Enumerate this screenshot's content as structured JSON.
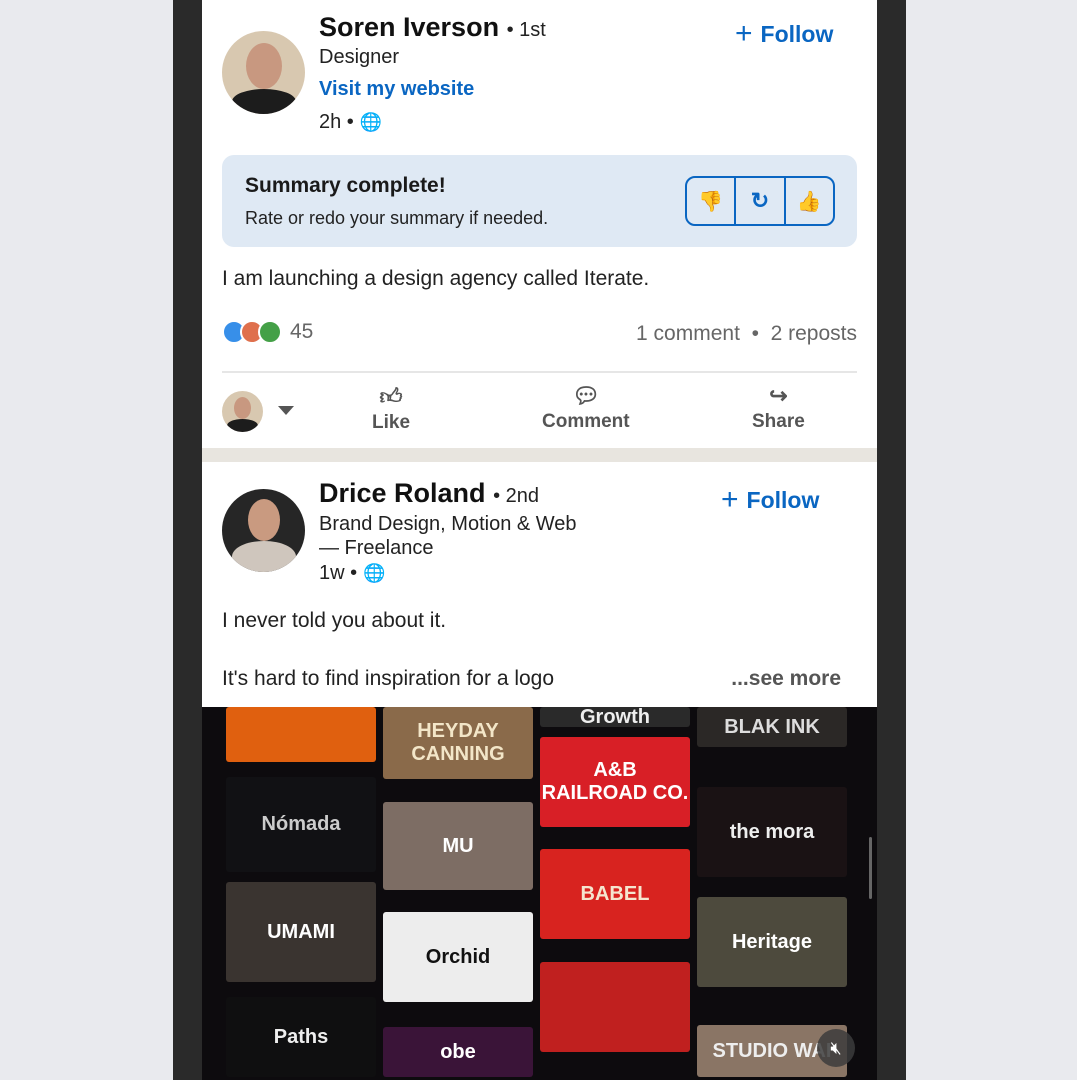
{
  "post1": {
    "author": "Soren Iverson",
    "degree": "• 1st",
    "headline": "Designer",
    "website_link": "Visit my website",
    "time": "2h •",
    "follow_label": "Follow",
    "summary": {
      "title": "Summary complete!",
      "subtitle": "Rate or redo your summary if needed."
    },
    "body": "I am launching a design agency called Iterate.",
    "reaction_count": "45",
    "comments": "1 comment",
    "reposts": "2 reposts",
    "actions": {
      "like": "Like",
      "comment": "Comment",
      "share": "Share"
    }
  },
  "post2": {
    "author": "Drice Roland",
    "degree": "• 2nd",
    "headline_1": "Brand Design, Motion & Web",
    "headline_2": "— Freelance",
    "time": "1w •",
    "follow_label": "Follow",
    "body_1": "I never told you about it.",
    "body_2": "It's hard to find inspiration for a logo",
    "see_more": "...see more",
    "video_tiles": [
      {
        "label": "",
        "bg": "#e0600f",
        "fg": "#fff"
      },
      {
        "label": "HEYDAY CANNING",
        "bg": "#8a6a4a",
        "fg": "#f3e6c8"
      },
      {
        "label": "Growth",
        "bg": "#2a2a2a",
        "fg": "#eee"
      },
      {
        "label": "BLAK INK",
        "bg": "#2b2826",
        "fg": "#ddd"
      },
      {
        "label": "Nómada",
        "bg": "#111114",
        "fg": "#ccc"
      },
      {
        "label": "MU",
        "bg": "#7d6d64",
        "fg": "#fff"
      },
      {
        "label": "A&B RAILROAD CO.",
        "bg": "#d81f26",
        "fg": "#fff"
      },
      {
        "label": "the mora",
        "bg": "#1a1214",
        "fg": "#eee"
      },
      {
        "label": "UMAMI",
        "bg": "#3a3430",
        "fg": "#fff"
      },
      {
        "label": "Orchid",
        "bg": "#ededed",
        "fg": "#111"
      },
      {
        "label": "BABEL",
        "bg": "#d8231f",
        "fg": "#f5e5cf"
      },
      {
        "label": "Heritage",
        "bg": "#4d4a3d",
        "fg": "#fff"
      },
      {
        "label": "Paths",
        "bg": "#0f0f10",
        "fg": "#eee"
      },
      {
        "label": "obe",
        "bg": "#3a1438",
        "fg": "#fff"
      },
      {
        "label": "",
        "bg": "#c0201f",
        "fg": "#fff"
      },
      {
        "label": "STUDIO WAI",
        "bg": "#8a7565",
        "fg": "#eee"
      }
    ]
  },
  "colors": {
    "accent": "#0a66c2",
    "summary_bg": "#dfe9f4"
  }
}
